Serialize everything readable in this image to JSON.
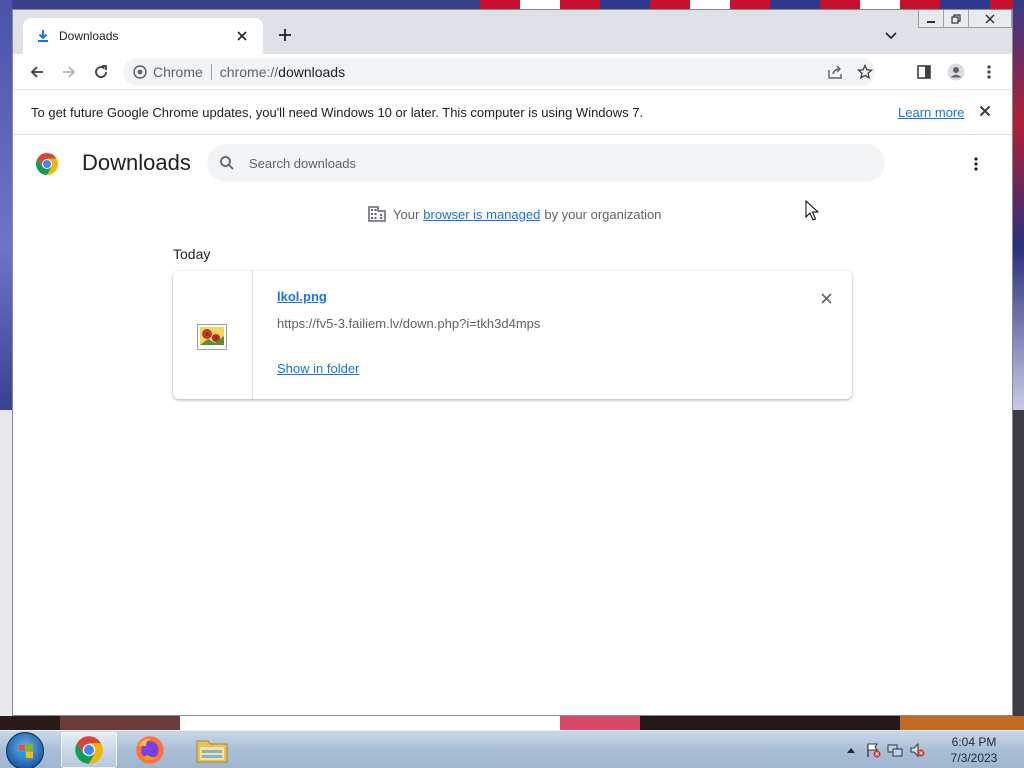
{
  "tab": {
    "title": "Downloads"
  },
  "toolbar": {
    "omnibox_label": "Chrome",
    "url_scheme": "chrome://",
    "url_host": "downloads"
  },
  "infobar": {
    "message": "To get future Google Chrome updates, you'll need Windows 10 or later. This computer is using Windows 7.",
    "learn_more": "Learn more"
  },
  "downloads": {
    "title": "Downloads",
    "search_placeholder": "Search downloads",
    "managed_prefix": "Your",
    "managed_link": "browser is managed",
    "managed_suffix": "by your organization",
    "section_label": "Today",
    "items": [
      {
        "file_name": "lkol.png",
        "url": "https://fv5-3.failiem.lv/down.php?i=tkh3d4mps",
        "action": "Show in folder"
      }
    ]
  },
  "taskbar": {
    "apps": [
      "chrome-icon",
      "firefox-icon",
      "file-explorer-icon"
    ],
    "clock_time": "6:04 PM",
    "clock_date": "7/3/2023"
  },
  "colors": {
    "accent": "#1a73e8",
    "title_bar": "#dee1e6",
    "omnibox": "#f1f3f4"
  }
}
